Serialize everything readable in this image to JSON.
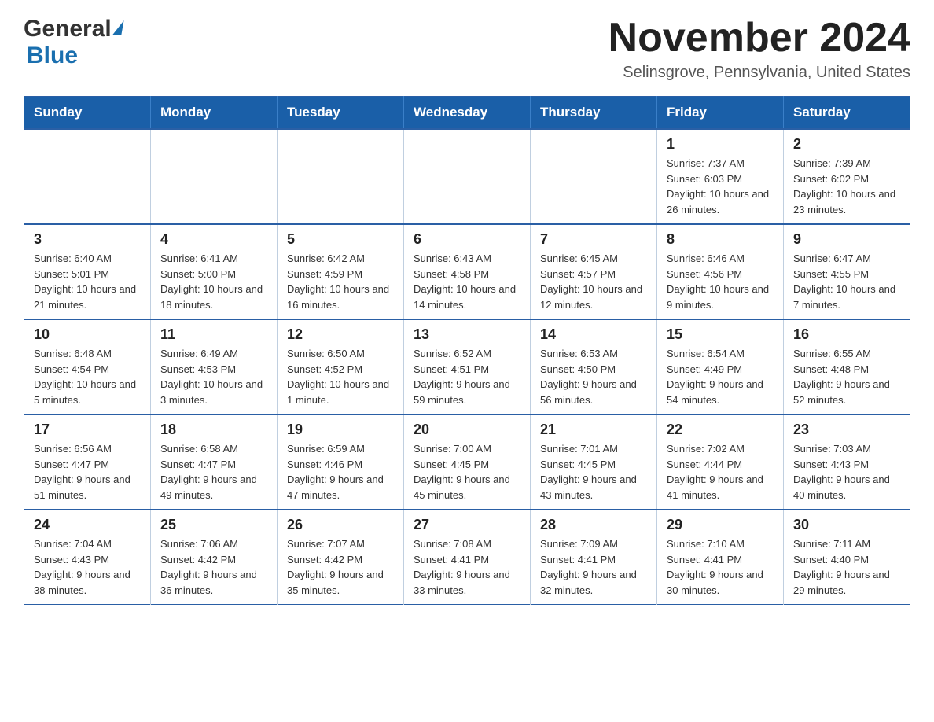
{
  "header": {
    "logo_general": "General",
    "logo_blue": "Blue",
    "month_title": "November 2024",
    "location": "Selinsgrove, Pennsylvania, United States"
  },
  "weekdays": [
    "Sunday",
    "Monday",
    "Tuesday",
    "Wednesday",
    "Thursday",
    "Friday",
    "Saturday"
  ],
  "weeks": [
    [
      {
        "day": "",
        "info": ""
      },
      {
        "day": "",
        "info": ""
      },
      {
        "day": "",
        "info": ""
      },
      {
        "day": "",
        "info": ""
      },
      {
        "day": "",
        "info": ""
      },
      {
        "day": "1",
        "info": "Sunrise: 7:37 AM\nSunset: 6:03 PM\nDaylight: 10 hours and 26 minutes."
      },
      {
        "day": "2",
        "info": "Sunrise: 7:39 AM\nSunset: 6:02 PM\nDaylight: 10 hours and 23 minutes."
      }
    ],
    [
      {
        "day": "3",
        "info": "Sunrise: 6:40 AM\nSunset: 5:01 PM\nDaylight: 10 hours and 21 minutes."
      },
      {
        "day": "4",
        "info": "Sunrise: 6:41 AM\nSunset: 5:00 PM\nDaylight: 10 hours and 18 minutes."
      },
      {
        "day": "5",
        "info": "Sunrise: 6:42 AM\nSunset: 4:59 PM\nDaylight: 10 hours and 16 minutes."
      },
      {
        "day": "6",
        "info": "Sunrise: 6:43 AM\nSunset: 4:58 PM\nDaylight: 10 hours and 14 minutes."
      },
      {
        "day": "7",
        "info": "Sunrise: 6:45 AM\nSunset: 4:57 PM\nDaylight: 10 hours and 12 minutes."
      },
      {
        "day": "8",
        "info": "Sunrise: 6:46 AM\nSunset: 4:56 PM\nDaylight: 10 hours and 9 minutes."
      },
      {
        "day": "9",
        "info": "Sunrise: 6:47 AM\nSunset: 4:55 PM\nDaylight: 10 hours and 7 minutes."
      }
    ],
    [
      {
        "day": "10",
        "info": "Sunrise: 6:48 AM\nSunset: 4:54 PM\nDaylight: 10 hours and 5 minutes."
      },
      {
        "day": "11",
        "info": "Sunrise: 6:49 AM\nSunset: 4:53 PM\nDaylight: 10 hours and 3 minutes."
      },
      {
        "day": "12",
        "info": "Sunrise: 6:50 AM\nSunset: 4:52 PM\nDaylight: 10 hours and 1 minute."
      },
      {
        "day": "13",
        "info": "Sunrise: 6:52 AM\nSunset: 4:51 PM\nDaylight: 9 hours and 59 minutes."
      },
      {
        "day": "14",
        "info": "Sunrise: 6:53 AM\nSunset: 4:50 PM\nDaylight: 9 hours and 56 minutes."
      },
      {
        "day": "15",
        "info": "Sunrise: 6:54 AM\nSunset: 4:49 PM\nDaylight: 9 hours and 54 minutes."
      },
      {
        "day": "16",
        "info": "Sunrise: 6:55 AM\nSunset: 4:48 PM\nDaylight: 9 hours and 52 minutes."
      }
    ],
    [
      {
        "day": "17",
        "info": "Sunrise: 6:56 AM\nSunset: 4:47 PM\nDaylight: 9 hours and 51 minutes."
      },
      {
        "day": "18",
        "info": "Sunrise: 6:58 AM\nSunset: 4:47 PM\nDaylight: 9 hours and 49 minutes."
      },
      {
        "day": "19",
        "info": "Sunrise: 6:59 AM\nSunset: 4:46 PM\nDaylight: 9 hours and 47 minutes."
      },
      {
        "day": "20",
        "info": "Sunrise: 7:00 AM\nSunset: 4:45 PM\nDaylight: 9 hours and 45 minutes."
      },
      {
        "day": "21",
        "info": "Sunrise: 7:01 AM\nSunset: 4:45 PM\nDaylight: 9 hours and 43 minutes."
      },
      {
        "day": "22",
        "info": "Sunrise: 7:02 AM\nSunset: 4:44 PM\nDaylight: 9 hours and 41 minutes."
      },
      {
        "day": "23",
        "info": "Sunrise: 7:03 AM\nSunset: 4:43 PM\nDaylight: 9 hours and 40 minutes."
      }
    ],
    [
      {
        "day": "24",
        "info": "Sunrise: 7:04 AM\nSunset: 4:43 PM\nDaylight: 9 hours and 38 minutes."
      },
      {
        "day": "25",
        "info": "Sunrise: 7:06 AM\nSunset: 4:42 PM\nDaylight: 9 hours and 36 minutes."
      },
      {
        "day": "26",
        "info": "Sunrise: 7:07 AM\nSunset: 4:42 PM\nDaylight: 9 hours and 35 minutes."
      },
      {
        "day": "27",
        "info": "Sunrise: 7:08 AM\nSunset: 4:41 PM\nDaylight: 9 hours and 33 minutes."
      },
      {
        "day": "28",
        "info": "Sunrise: 7:09 AM\nSunset: 4:41 PM\nDaylight: 9 hours and 32 minutes."
      },
      {
        "day": "29",
        "info": "Sunrise: 7:10 AM\nSunset: 4:41 PM\nDaylight: 9 hours and 30 minutes."
      },
      {
        "day": "30",
        "info": "Sunrise: 7:11 AM\nSunset: 4:40 PM\nDaylight: 9 hours and 29 minutes."
      }
    ]
  ]
}
